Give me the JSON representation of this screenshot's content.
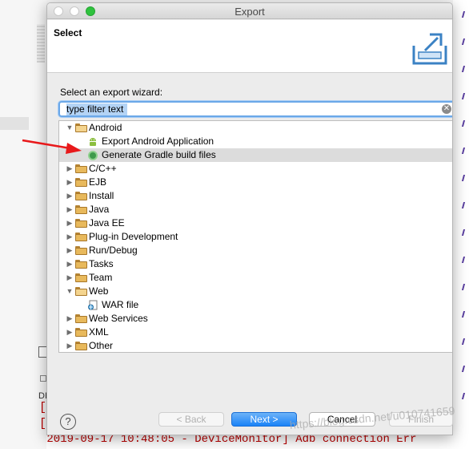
{
  "window": {
    "title": "Export"
  },
  "header": {
    "title": "Select"
  },
  "wizard": {
    "label": "Select an export wizard:",
    "filter": {
      "value": "type filter text",
      "placeholder": "type filter text"
    }
  },
  "tree": {
    "items": [
      {
        "label": "Android",
        "expanded": true,
        "icon": "folder-open-icon"
      },
      {
        "label": "Export Android Application",
        "icon": "android-icon"
      },
      {
        "label": "Generate Gradle build files",
        "icon": "gradle-icon",
        "selected": true
      },
      {
        "label": "C/C++",
        "icon": "folder-icon"
      },
      {
        "label": "EJB",
        "icon": "folder-icon"
      },
      {
        "label": "Install",
        "icon": "folder-icon"
      },
      {
        "label": "Java",
        "icon": "folder-icon"
      },
      {
        "label": "Java EE",
        "icon": "folder-icon"
      },
      {
        "label": "Plug-in Development",
        "icon": "folder-icon"
      },
      {
        "label": "Run/Debug",
        "icon": "folder-icon"
      },
      {
        "label": "Tasks",
        "icon": "folder-icon"
      },
      {
        "label": "Team",
        "icon": "folder-icon"
      },
      {
        "label": "Web",
        "expanded": true,
        "icon": "folder-open-icon"
      },
      {
        "label": "WAR file",
        "icon": "war-file-icon"
      },
      {
        "label": "Web Services",
        "icon": "folder-icon"
      },
      {
        "label": "XML",
        "icon": "folder-icon"
      },
      {
        "label": "Other",
        "icon": "folder-icon"
      }
    ]
  },
  "buttons": {
    "back": "< Back",
    "next": "Next >",
    "cancel": "Cancel",
    "finish": "Finish",
    "help": "?"
  },
  "background": {
    "console_lines": [
      "[",
      "[",
      "[2019-09-17 10:48:05 - DeviceMonitor] Adb connection Err"
    ],
    "side_label": "DI"
  },
  "watermark": "https://blog.csdn.net/u010741659",
  "colors": {
    "accent": "#1a82f7",
    "selection": "#dcdcdc",
    "annotation_arrow": "#e8191b"
  }
}
